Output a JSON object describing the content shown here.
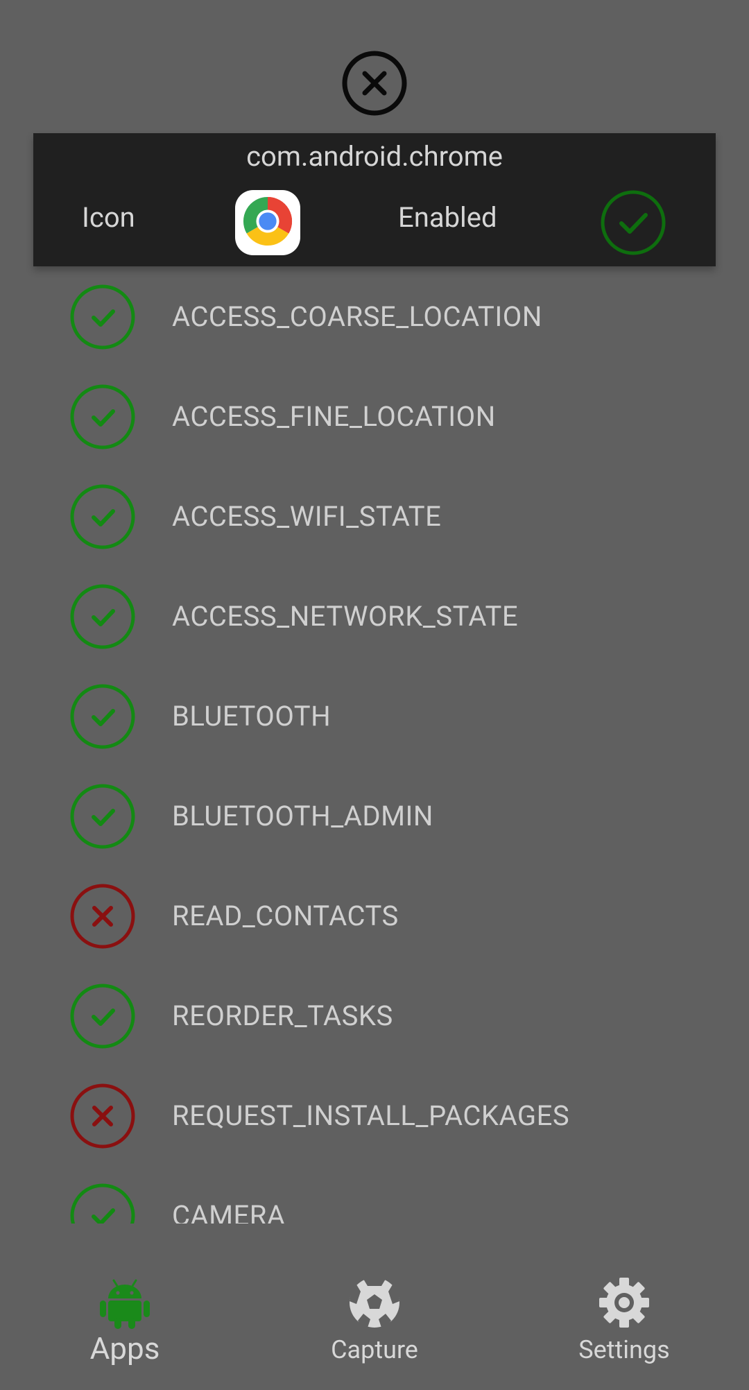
{
  "dialog": {
    "package_name": "com.android.chrome",
    "icon_label": "Icon",
    "enabled_label": "Enabled",
    "enabled": true
  },
  "permissions": [
    {
      "name": "ACCESS_COARSE_LOCATION",
      "granted": true
    },
    {
      "name": "ACCESS_FINE_LOCATION",
      "granted": true
    },
    {
      "name": "ACCESS_WIFI_STATE",
      "granted": true
    },
    {
      "name": "ACCESS_NETWORK_STATE",
      "granted": true
    },
    {
      "name": "BLUETOOTH",
      "granted": true
    },
    {
      "name": "BLUETOOTH_ADMIN",
      "granted": true
    },
    {
      "name": "READ_CONTACTS",
      "granted": false
    },
    {
      "name": "REORDER_TASKS",
      "granted": true
    },
    {
      "name": "REQUEST_INSTALL_PACKAGES",
      "granted": false
    },
    {
      "name": "CAMERA",
      "granted": true
    }
  ],
  "nav": {
    "apps": "Apps",
    "capture": "Capture",
    "settings": "Settings"
  },
  "colors": {
    "background": "#606060",
    "panel": "#202020",
    "granted": "#138a13",
    "denied": "#8a1010",
    "android_green": "#1a8a1a",
    "text": "#d6d6d6"
  },
  "icons": {
    "close": "close-circle-icon",
    "app": "chrome-icon",
    "granted": "check-circle-icon",
    "denied": "x-circle-icon",
    "apps_tab": "android-icon",
    "capture_tab": "soccer-ball-icon",
    "settings_tab": "gear-icon"
  }
}
